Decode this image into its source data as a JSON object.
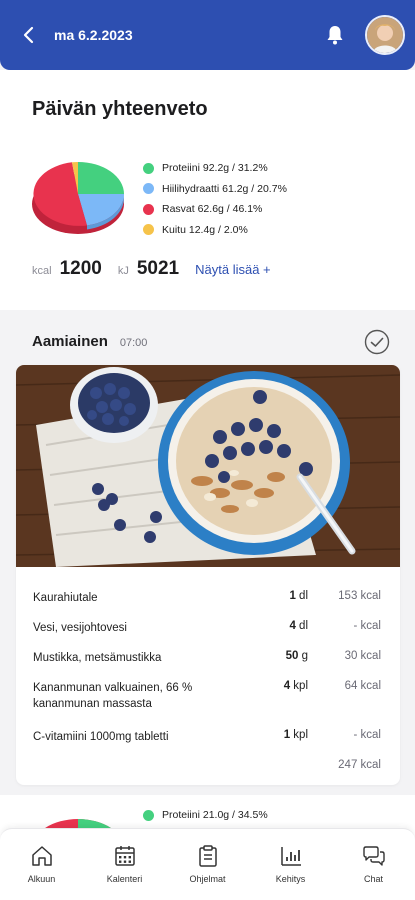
{
  "header": {
    "date": "ma 6.2.2023"
  },
  "summary": {
    "title": "Päivän yhteenveto",
    "legend": [
      {
        "label": "Proteiini 92.2g / 31.2%",
        "color": "#44d07f"
      },
      {
        "label": "Hiilihydraatti 61.2g / 20.7%",
        "color": "#7cb8f7"
      },
      {
        "label": "Rasvat 62.6g / 46.1%",
        "color": "#e8334e"
      },
      {
        "label": "Kuitu 12.4g / 2.0%",
        "color": "#f6c34a"
      }
    ],
    "kcal_unit": "kcal",
    "kcal_value": "1200",
    "kj_unit": "kJ",
    "kj_value": "5021",
    "more_label": "Näytä lisää +"
  },
  "meal": {
    "title": "Aamiainen",
    "time": "07:00",
    "ingredients": [
      {
        "name": "Kaurahiutale",
        "qty": "1",
        "unit": "dl",
        "kcal": "153 kcal"
      },
      {
        "name": "Vesi, vesijohtovesi",
        "qty": "4",
        "unit": "dl",
        "kcal": "- kcal"
      },
      {
        "name": "Mustikka, metsämustikka",
        "qty": "50",
        "unit": "g",
        "kcal": "30 kcal"
      },
      {
        "name": "Kananmunan valkuainen, 66 % kananmunan massasta",
        "qty": "4",
        "unit": "kpl",
        "kcal": "64 kcal"
      },
      {
        "name": "C-vitamiini 1000mg tabletti",
        "qty": "1",
        "unit": "kpl",
        "kcal": "- kcal"
      }
    ],
    "total": "247 kcal"
  },
  "next_meal": {
    "legend": [
      {
        "label": "Proteiini 21.0g / 34.5%",
        "color": "#44d07f"
      },
      {
        "label": "",
        "color": "#7cb8f7"
      }
    ]
  },
  "tabs": [
    {
      "label": "Alkuun",
      "icon": "home-icon"
    },
    {
      "label": "Kalenteri",
      "icon": "calendar-icon"
    },
    {
      "label": "Ohjelmat",
      "icon": "clipboard-icon"
    },
    {
      "label": "Kehitys",
      "icon": "bar-chart-icon"
    },
    {
      "label": "Chat",
      "icon": "chat-icon"
    }
  ]
}
